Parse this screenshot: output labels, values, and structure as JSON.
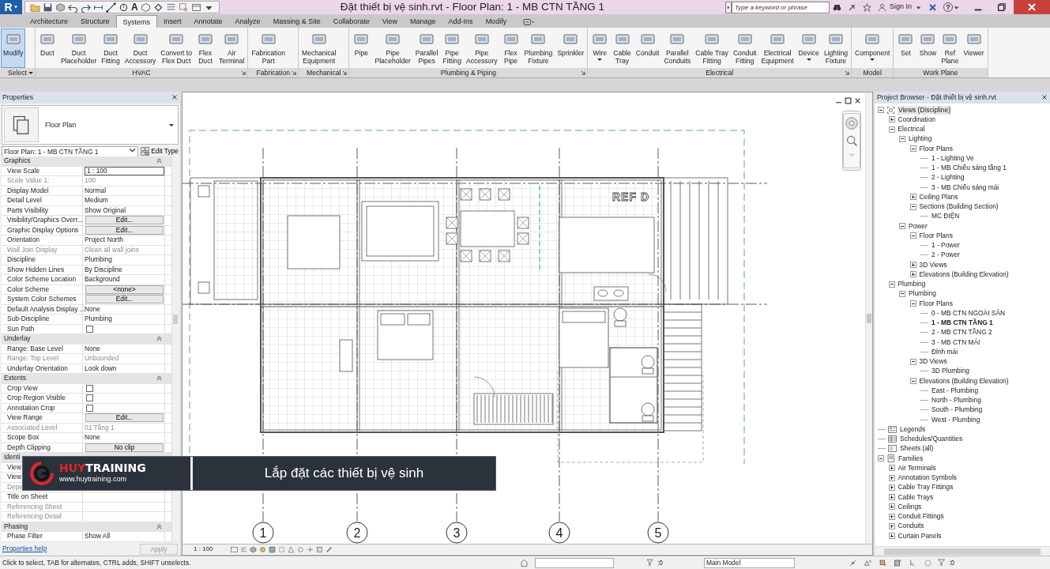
{
  "app_button": {
    "label": "R"
  },
  "quick_access_text": "A",
  "title": "Đặt thiết bị vệ sinh.rvt - Floor Plan: 1 - MB CTN TẦNG 1",
  "search": {
    "placeholder": "Type a keyword or phrase"
  },
  "sign_in": "Sign In",
  "help": "?",
  "tabs": [
    {
      "label": "Architecture",
      "selected": false
    },
    {
      "label": "Structure",
      "selected": false
    },
    {
      "label": "Systems",
      "selected": true
    },
    {
      "label": "Insert",
      "selected": false
    },
    {
      "label": "Annotate",
      "selected": false
    },
    {
      "label": "Analyze",
      "selected": false
    },
    {
      "label": "Massing & Site",
      "selected": false
    },
    {
      "label": "Collaborate",
      "selected": false
    },
    {
      "label": "View",
      "selected": false
    },
    {
      "label": "Manage",
      "selected": false
    },
    {
      "label": "Add-Ins",
      "selected": false
    },
    {
      "label": "Modify",
      "selected": false
    }
  ],
  "ribbon_panels": [
    {
      "name": "Select",
      "has_menu": true,
      "has_launcher": false,
      "buttons": [
        {
          "label": "Modify",
          "selected": true,
          "menu": false
        }
      ]
    },
    {
      "name": "HVAC",
      "has_menu": false,
      "has_launcher": true,
      "buttons": [
        {
          "label": "Duct",
          "selected": false,
          "menu": false
        },
        {
          "label": "Duct\nPlaceholder",
          "selected": false,
          "menu": false
        },
        {
          "label": "Duct\nFitting",
          "selected": false,
          "menu": false
        },
        {
          "label": "Duct\nAccessory",
          "selected": false,
          "menu": false
        },
        {
          "label": "Convert to\nFlex Duct",
          "selected": false,
          "menu": false
        },
        {
          "label": "Flex\nDuct",
          "selected": false,
          "menu": false
        },
        {
          "label": "Air\nTerminal",
          "selected": false,
          "menu": false
        }
      ]
    },
    {
      "name": "Fabrication",
      "has_menu": false,
      "has_launcher": true,
      "buttons": [
        {
          "label": "Fabrication\nPart",
          "selected": false,
          "menu": false
        }
      ]
    },
    {
      "name": "Mechanical",
      "has_menu": false,
      "has_launcher": true,
      "buttons": [
        {
          "label": "Mechanical\nEquipment",
          "selected": false,
          "menu": false
        }
      ]
    },
    {
      "name": "Plumbing & Piping",
      "has_menu": false,
      "has_launcher": true,
      "buttons": [
        {
          "label": "Pipe",
          "selected": false,
          "menu": false
        },
        {
          "label": "Pipe\nPlaceholder",
          "selected": false,
          "menu": false
        },
        {
          "label": "Parallel\nPipes",
          "selected": false,
          "menu": false
        },
        {
          "label": "Pipe\nFitting",
          "selected": false,
          "menu": false
        },
        {
          "label": "Pipe\nAccessory",
          "selected": false,
          "menu": false
        },
        {
          "label": "Flex\nPipe",
          "selected": false,
          "menu": false
        },
        {
          "label": "Plumbing\nFixture",
          "selected": false,
          "menu": false
        },
        {
          "label": "Sprinkler",
          "selected": false,
          "menu": false
        }
      ]
    },
    {
      "name": "Electrical",
      "has_menu": false,
      "has_launcher": true,
      "buttons": [
        {
          "label": "Wire",
          "selected": false,
          "menu": true
        },
        {
          "label": "Cable\nTray",
          "selected": false,
          "menu": false
        },
        {
          "label": "Conduit",
          "selected": false,
          "menu": false
        },
        {
          "label": "Parallel\nConduits",
          "selected": false,
          "menu": false
        },
        {
          "label": "Cable Tray\nFitting",
          "selected": false,
          "menu": false
        },
        {
          "label": "Conduit\nFitting",
          "selected": false,
          "menu": false
        },
        {
          "label": "Electrical\nEquipment",
          "selected": false,
          "menu": false
        },
        {
          "label": "Device",
          "selected": false,
          "menu": true
        },
        {
          "label": "Lighting\nFixture",
          "selected": false,
          "menu": false
        }
      ]
    },
    {
      "name": "Model",
      "has_menu": false,
      "has_launcher": false,
      "buttons": [
        {
          "label": "Component",
          "selected": false,
          "menu": true
        }
      ]
    },
    {
      "name": "Work Plane",
      "has_menu": false,
      "has_launcher": false,
      "buttons": [
        {
          "label": "Set",
          "selected": false,
          "menu": false
        },
        {
          "label": "Show",
          "selected": false,
          "menu": false
        },
        {
          "label": "Ref\nPlane",
          "selected": false,
          "menu": false
        },
        {
          "label": "Viewer",
          "selected": false,
          "menu": false
        }
      ]
    }
  ],
  "properties": {
    "title": "Properties",
    "type_name": "Floor Plan",
    "instance": "Floor Plan: 1 - MB CTN TẦNG 1",
    "edit_type": "Edit Type",
    "rows": [
      {
        "kind": "section",
        "label": "Graphics",
        "expanded": true
      },
      {
        "kind": "field",
        "label": "View Scale",
        "value": "1 : 100"
      },
      {
        "kind": "text",
        "label": "Scale Value    1:",
        "value": "100",
        "disabled": true
      },
      {
        "kind": "text",
        "label": "Display Model",
        "value": "Normal",
        "disabled": false
      },
      {
        "kind": "text",
        "label": "Detail Level",
        "value": "Medium",
        "disabled": false
      },
      {
        "kind": "text",
        "label": "Parts Visibility",
        "value": "Show Original",
        "disabled": false
      },
      {
        "kind": "button",
        "label": "Visibility/Graphics Overr...",
        "value": "Edit..."
      },
      {
        "kind": "button",
        "label": "Graphic Display Options",
        "value": "Edit..."
      },
      {
        "kind": "text",
        "label": "Orientation",
        "value": "Project North",
        "disabled": false
      },
      {
        "kind": "text",
        "label": "Wall Join Display",
        "value": "Clean all wall joins",
        "disabled": true
      },
      {
        "kind": "text",
        "label": "Discipline",
        "value": "Plumbing",
        "disabled": false
      },
      {
        "kind": "text",
        "label": "Show Hidden Lines",
        "value": "By Discipline",
        "disabled": false
      },
      {
        "kind": "text",
        "label": "Color Scheme Location",
        "value": "Background",
        "disabled": false
      },
      {
        "kind": "button",
        "label": "Color Scheme",
        "value": "<none>"
      },
      {
        "kind": "button",
        "label": "System Color Schemes",
        "value": "Edit..."
      },
      {
        "kind": "text",
        "label": "Default Analysis Display ...",
        "value": "None",
        "disabled": false
      },
      {
        "kind": "text",
        "label": "Sub-Discipline",
        "value": "Plumbing",
        "disabled": false
      },
      {
        "kind": "checkbox",
        "label": "Sun Path",
        "checked": false
      },
      {
        "kind": "section",
        "label": "Underlay",
        "expanded": true
      },
      {
        "kind": "text",
        "label": "Range: Base Level",
        "value": "None",
        "disabled": false
      },
      {
        "kind": "text",
        "label": "Range: Top Level",
        "value": "Unbounded",
        "disabled": true
      },
      {
        "kind": "text",
        "label": "Underlay Orientation",
        "value": "Look down",
        "disabled": false
      },
      {
        "kind": "section",
        "label": "Extents",
        "expanded": true
      },
      {
        "kind": "checkbox",
        "label": "Crop View",
        "checked": false
      },
      {
        "kind": "checkbox",
        "label": "Crop Region Visible",
        "checked": false
      },
      {
        "kind": "checkbox",
        "label": "Annotation Crop",
        "checked": false
      },
      {
        "kind": "button",
        "label": "View Range",
        "value": "Edit..."
      },
      {
        "kind": "text",
        "label": "Associated Level",
        "value": "01 Tầng 1",
        "disabled": true
      },
      {
        "kind": "text",
        "label": "Scope Box",
        "value": "None",
        "disabled": false
      },
      {
        "kind": "button",
        "label": "Depth Clipping",
        "value": "No clip"
      },
      {
        "kind": "section",
        "label": "Identi"
      },
      {
        "kind": "text",
        "label": "View",
        "disabled": false
      },
      {
        "kind": "text",
        "label": "View",
        "disabled": false
      },
      {
        "kind": "text",
        "label": "Depe",
        "disabled": true
      },
      {
        "kind": "text",
        "label": "Title on Sheet",
        "disabled": false
      },
      {
        "kind": "text",
        "label": "Referencing Sheet",
        "disabled": true
      },
      {
        "kind": "text",
        "label": "Referencing Detail",
        "disabled": true
      },
      {
        "kind": "section",
        "label": "Phasing",
        "expanded": true
      },
      {
        "kind": "text",
        "label": "Phase Filter",
        "value": "Show All",
        "disabled": false
      }
    ],
    "help_link": "Properties help",
    "apply": "Apply"
  },
  "caption": {
    "brand_accent": "HUY",
    "brand_rest": "TRAINING",
    "url": "www.huytraining.com",
    "text": "Lắp đặt các thiết bị vệ sinh"
  },
  "view": {
    "ref_label": "REF D",
    "grid_labels": [
      "1",
      "2",
      "3",
      "4",
      "5"
    ],
    "scale": "1 : 100"
  },
  "project_browser": {
    "title": "Project Browser - Đặt thiết bị vệ sinh.rvt",
    "tree": [
      {
        "label": "Views (Discipline)",
        "kind": "views",
        "expanded": true,
        "children": [
          {
            "label": "Coordination",
            "expanded": false
          },
          {
            "label": "Electrical",
            "expanded": true,
            "children": [
              {
                "label": "Lighting",
                "expanded": true,
                "children": [
                  {
                    "label": "Floor Plans",
                    "expanded": true,
                    "children": [
                      {
                        "label": "1 - Lighting Ve"
                      },
                      {
                        "label": "1 - MB Chiếu sáng tầng 1"
                      },
                      {
                        "label": "2 - Lighting"
                      },
                      {
                        "label": "3 - MB Chiếu sáng mái"
                      }
                    ]
                  },
                  {
                    "label": "Ceiling Plans",
                    "expanded": false
                  },
                  {
                    "label": "Sections (Building Section)",
                    "expanded": true,
                    "children": [
                      {
                        "label": "MC ĐIỆN"
                      }
                    ]
                  }
                ]
              },
              {
                "label": "Power",
                "expanded": true,
                "children": [
                  {
                    "label": "Floor Plans",
                    "expanded": true,
                    "children": [
                      {
                        "label": "1 - Power"
                      },
                      {
                        "label": "2 - Power"
                      }
                    ]
                  },
                  {
                    "label": "3D Views",
                    "expanded": false
                  },
                  {
                    "label": "Elevations (Building Elevation)",
                    "expanded": false
                  }
                ]
              }
            ]
          },
          {
            "label": "Plumbing",
            "expanded": true,
            "children": [
              {
                "label": "Plumbing",
                "expanded": true,
                "children": [
                  {
                    "label": "Floor Plans",
                    "expanded": true,
                    "children": [
                      {
                        "label": "0 - MB CTN NGOÀI SÂN",
                        "current": false
                      },
                      {
                        "label": "1 - MB CTN TẦNG 1",
                        "current": true
                      },
                      {
                        "label": "2 - MB CTN TẦNG 2",
                        "current": false
                      },
                      {
                        "label": "3 -  MB CTN MÁI",
                        "current": false
                      },
                      {
                        "label": "Đỉnh mái",
                        "current": false
                      }
                    ]
                  },
                  {
                    "label": "3D Views",
                    "expanded": true,
                    "children": [
                      {
                        "label": "3D Plumbing"
                      }
                    ]
                  },
                  {
                    "label": "Elevations (Building Elevation)",
                    "expanded": true,
                    "children": [
                      {
                        "label": "East - Plumbing"
                      },
                      {
                        "label": "North - Plumbing"
                      },
                      {
                        "label": "South - Plumbing"
                      },
                      {
                        "label": "West - Plumbing"
                      }
                    ]
                  }
                ]
              }
            ]
          }
        ]
      },
      {
        "label": "Legends",
        "kind": "legends"
      },
      {
        "label": "Schedules/Quantities",
        "kind": "schedules"
      },
      {
        "label": "Sheets (all)",
        "kind": "sheets"
      },
      {
        "label": "Families",
        "kind": "families",
        "expanded": true,
        "children": [
          {
            "label": "Air Terminals",
            "expanded": false
          },
          {
            "label": "Annotation Symbols",
            "expanded": false
          },
          {
            "label": "Cable Tray Fittings",
            "expanded": false
          },
          {
            "label": "Cable Trays",
            "expanded": false
          },
          {
            "label": "Ceilings",
            "expanded": false
          },
          {
            "label": "Conduit Fittings",
            "expanded": false
          },
          {
            "label": "Conduits",
            "expanded": false
          },
          {
            "label": "Curtain Panels",
            "expanded": false
          }
        ]
      }
    ]
  },
  "status_bar": {
    "message": "Click to select, TAB for alternates, CTRL adds, SHIFT unselects.",
    "count_1": ":0",
    "workset": "Main Model",
    "count_2": ":0"
  }
}
